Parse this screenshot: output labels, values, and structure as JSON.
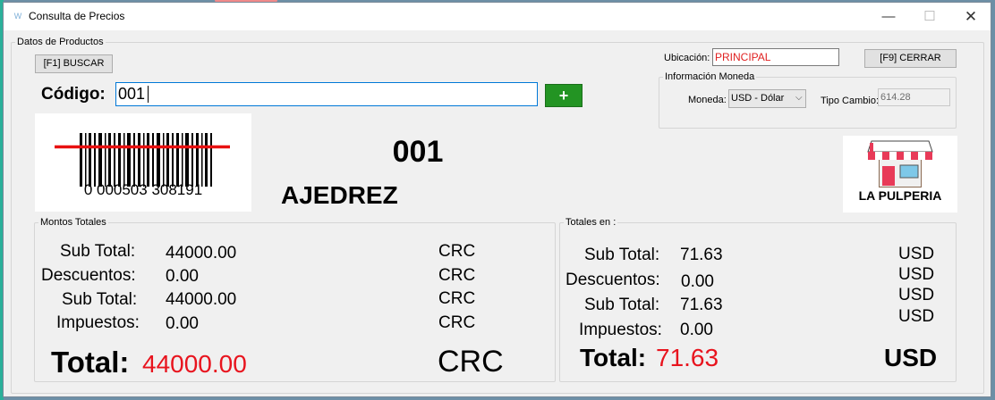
{
  "window": {
    "title": "Consulta de Precios",
    "app_icon": "W",
    "minimize_glyph": "—",
    "maximize_glyph": "☐",
    "close_glyph": "✕"
  },
  "datos_productos": {
    "legend": "Datos de Productos",
    "buscar_label": "[F1] BUSCAR",
    "codigo_label": "Código:",
    "codigo_value": "001",
    "add_label": "+",
    "barcode_text": "0 000503 308191",
    "product_code": "001",
    "product_name": "AJEDREZ",
    "store_name": "LA PULPERIA"
  },
  "ubicacion": {
    "label": "Ubicación:",
    "value": "PRINCIPAL"
  },
  "cerrar_label": "[F9] CERRAR",
  "moneda_info": {
    "legend": "Información Moneda",
    "moneda_label": "Moneda:",
    "moneda_value": "USD - Dólar",
    "tipo_cambio_label": "Tipo Cambio:",
    "tipo_cambio_value": "614.28"
  },
  "montos_totales": {
    "legend": "Montos Totales",
    "subtotal_label": "Sub Total:",
    "subtotal_value": "44000.00",
    "descuentos_label": "Descuentos:",
    "descuentos_value": "0.00",
    "subtotal2_label": "Sub Total:",
    "subtotal2_value": "44000.00",
    "impuestos_label": "Impuestos:",
    "impuestos_value": "0.00",
    "total_label": "Total:",
    "total_value": "44000.00",
    "currency": "CRC"
  },
  "totales_en": {
    "legend": "Totales en :",
    "subtotal_label": "Sub Total:",
    "subtotal_value": "71.63",
    "descuentos_label": "Descuentos:",
    "descuentos_value": "0.00",
    "subtotal2_label": "Sub Total:",
    "subtotal2_value": "71.63",
    "impuestos_label": "Impuestos:",
    "impuestos_value": "0.00",
    "total_label": "Total:",
    "total_value": "71.63",
    "currency": "USD"
  },
  "colors": {
    "accent_green": "#239423",
    "total_red": "#e8141e",
    "focus_blue": "#0078d7"
  }
}
